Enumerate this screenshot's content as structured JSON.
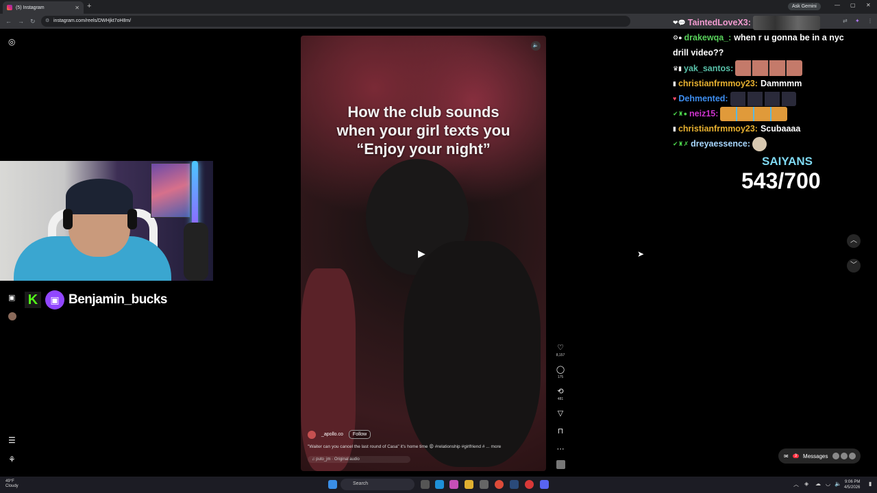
{
  "browser": {
    "tab_title": "(5) Instagram",
    "new_tab": "+",
    "ask_gemini": "Ask Gemini",
    "url": "instagram.com/reels/DWHjkt7oH8m/"
  },
  "reel": {
    "overlay_text_lines": [
      "How the club sounds",
      "when your girl texts you",
      "“Enjoy your night”"
    ],
    "author": "_apollo.co",
    "follow_label": "Follow",
    "description": "\"Waiter can you cancel the last round of Casa\" it's home time 😩 #relationship #girlfriend # ... more",
    "audio": "puto_jm · Original audio"
  },
  "actions": [
    {
      "name": "like",
      "icon": "heart-icon",
      "count": "8,157"
    },
    {
      "name": "comment",
      "icon": "comment-icon",
      "count": "175"
    },
    {
      "name": "repost",
      "icon": "repost-icon",
      "count": "481"
    },
    {
      "name": "share",
      "icon": "send-icon",
      "count": ""
    },
    {
      "name": "save",
      "icon": "bookmark-icon",
      "count": ""
    },
    {
      "name": "more",
      "icon": "more-icon",
      "count": ""
    }
  ],
  "streamer": {
    "handle": "Benjamin_bucks",
    "kick_letter": "K"
  },
  "chat": [
    {
      "user": "TaintedLoveX3:",
      "color": "#f29bd0",
      "msg": ""
    },
    {
      "user": "drakewqa_:",
      "color": "#58d05a",
      "msg": "when r u gonna be in a nyc"
    },
    {
      "user": "",
      "color": "#ffffff",
      "msg": "drill video??"
    },
    {
      "user": "yak_santos:",
      "color": "#58c0a8",
      "msg": ""
    },
    {
      "user": "christianfrmmoy23:",
      "color": "#e6b030",
      "msg": "Dammmm"
    },
    {
      "user": "Dehmented:",
      "color": "#3e8ef0",
      "msg": ""
    },
    {
      "user": "neiz15:",
      "color": "#cc33cc",
      "msg": ""
    },
    {
      "user": "christianfrmmoy23:",
      "color": "#e6b030",
      "msg": "Scubaaaa"
    },
    {
      "user": "dreyaessence:",
      "color": "#a8d8ff",
      "msg": ""
    }
  ],
  "goal": {
    "title": "SAIYANS",
    "count": "543/700"
  },
  "messages_label": "Messages",
  "messages_badge": "3",
  "taskbar": {
    "temp": "49°F",
    "condition": "Cloudy",
    "search": "Search",
    "time": "9:06 PM",
    "date": "4/5/2026"
  }
}
